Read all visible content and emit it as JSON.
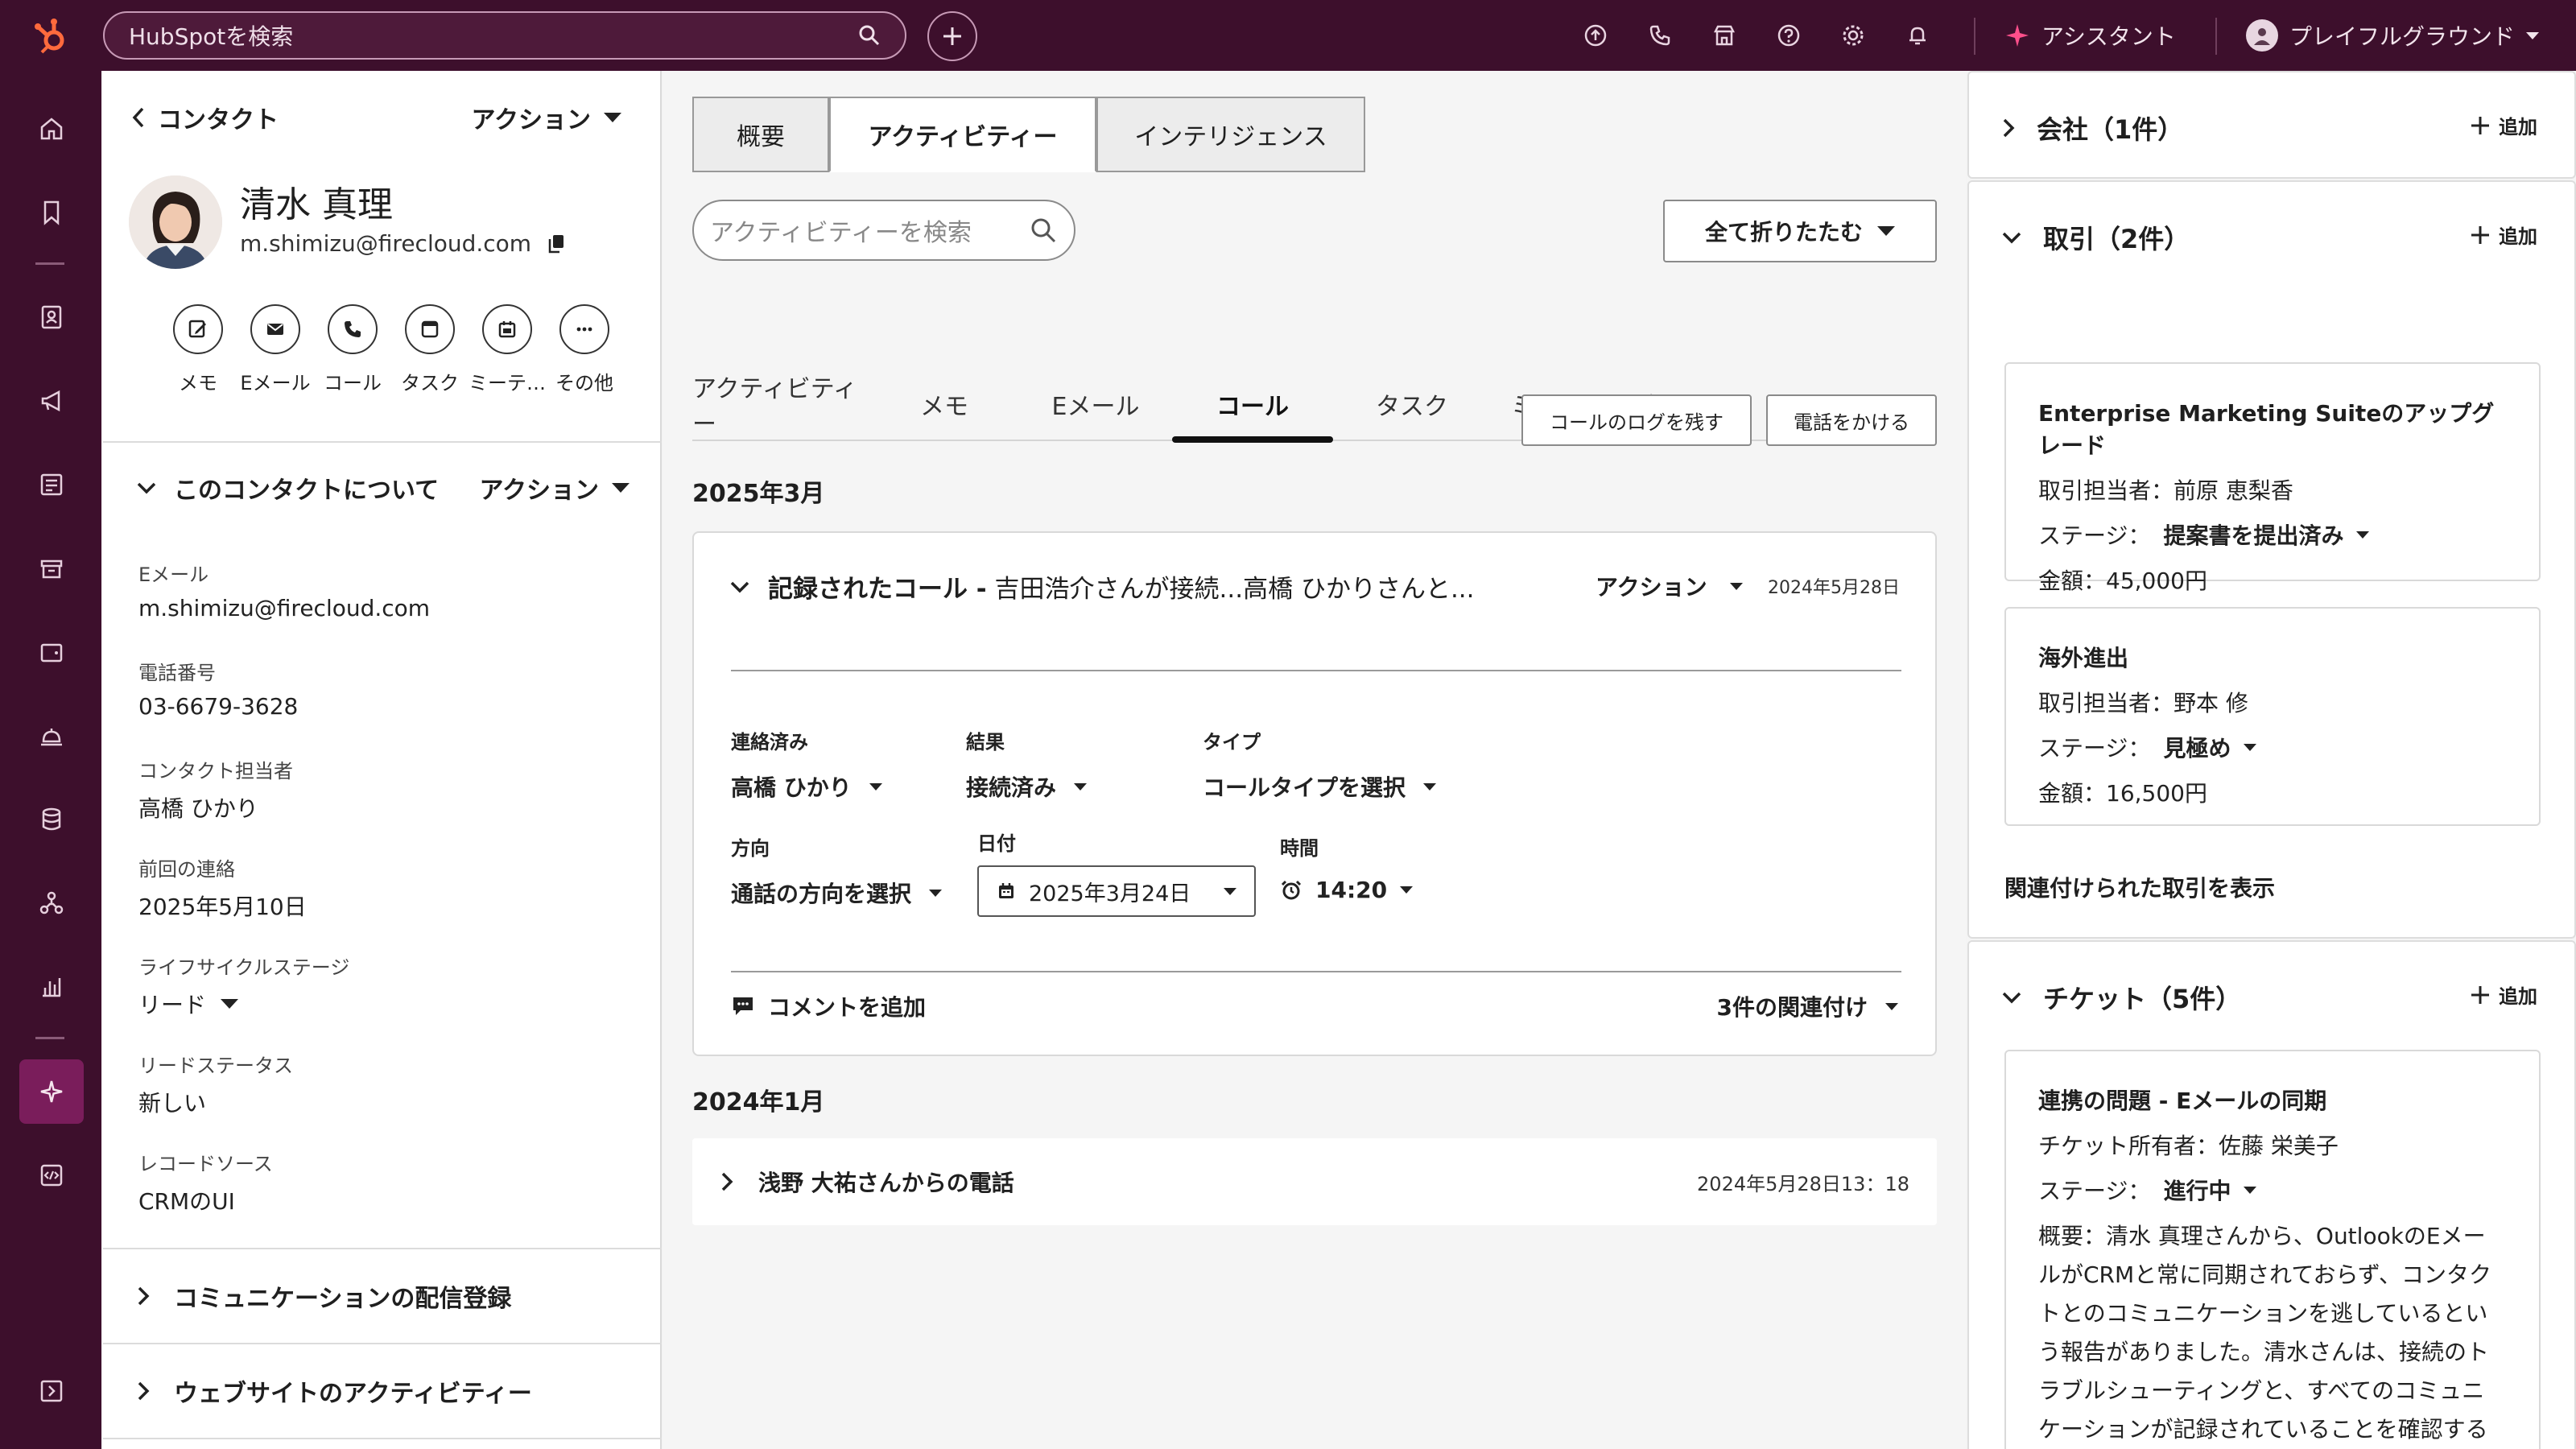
{
  "topbar": {
    "search_placeholder": "HubSpotを検索",
    "assistant_label": "アシスタント",
    "account_label": "プレイフルグラウンド",
    "accent_color": "#3d0f2c"
  },
  "leftpanel": {
    "back_label": "コンタクト",
    "action_label": "アクション",
    "contact_name": "清水 真理",
    "contact_email": "m.shimizu@firecloud.com",
    "quick_actions": [
      "メモ",
      "Eメール",
      "コール",
      "タスク",
      "ミーテ…",
      "その他"
    ],
    "about_title": "このコンタクトについて",
    "about_action": "アクション",
    "properties": [
      {
        "label": "Eメール",
        "value": "m.shimizu@firecloud.com"
      },
      {
        "label": "電話番号",
        "value": "03-6679-3628"
      },
      {
        "label": "コンタクト担当者",
        "value": "高橋 ひかり"
      },
      {
        "label": "前回の連絡",
        "value": "2025年5月10日"
      },
      {
        "label": "ライフサイクルステージ",
        "value": "リード"
      },
      {
        "label": "リードステータス",
        "value": "新しい"
      },
      {
        "label": "レコードソース",
        "value": "CRMのUI"
      }
    ],
    "sections": [
      "コミュニケーションの配信登録",
      "ウェブサイトのアクティビティー"
    ]
  },
  "middle": {
    "top_tabs": [
      "概要",
      "アクティビティー",
      "インテリジェンス"
    ],
    "activity_search_placeholder": "アクティビティーを検索",
    "collapse_all_label": "全て折りたたむ",
    "sub_tabs": [
      "アクティビティー",
      "メモ",
      "Eメール",
      "コール",
      "タスク",
      "ミーティング"
    ],
    "log_call_label": "コールのログを残す",
    "make_call_label": "電話をかける",
    "month_1": "2025年3月",
    "call": {
      "title_bold": "記録されたコール -",
      "title_rest": "吉田浩介さんが接続...高橋 ひかりさんと...",
      "action_label": "アクション",
      "date": "2024年5月28日",
      "contacted_label": "連絡済み",
      "contacted_value": "高橋 ひかり",
      "outcome_label": "結果",
      "outcome_value": "接続済み",
      "type_label": "タイプ",
      "type_value": "コールタイプを選択",
      "direction_label": "方向",
      "direction_value": "通話の方向を選択",
      "date_label": "日付",
      "date_value": "2025年3月24日",
      "time_label": "時間",
      "time_value": "14:20",
      "comment_label": "コメントを追加",
      "associations_label": "3件の関連付け"
    },
    "month_2": "2024年1月",
    "row_call": {
      "title": "浅野 大祐さんからの電話",
      "date": "2024年5月28日13：18"
    }
  },
  "right": {
    "add_label": "追加",
    "company_title": "会社（1件）",
    "deals_title": "取引（2件）",
    "deals": [
      {
        "title": "Enterprise Marketing Suiteのアップグレード",
        "owner": "取引担当者：前原 恵梨香",
        "stage_label": "ステージ：",
        "stage_value": "提案書を提出済み",
        "amount": "金額：45,000円"
      },
      {
        "title": "海外進出",
        "owner": "取引担当者：野本 修",
        "stage_label": "ステージ：",
        "stage_value": "見極め",
        "amount": "金額：16,500円"
      }
    ],
    "deals_link": "関連付けられた取引を表示",
    "tickets_title": "チケット（5件）",
    "ticket": {
      "title": "連携の問題 - Eメールの同期",
      "owner": "チケット所有者：佐藤 栄美子",
      "stage_label": "ステージ：",
      "stage_value": "進行中",
      "summary": "概要：清水 真理さんから、OutlookのEメールがCRMと常に同期されておらず、コンタクトとのコミュニケーションを逃しているという報告がありました。清水さんは、接続のトラブルシューティングと、すべてのコミュニケーションが記録されていることを確認するためのサポートを必要としています。"
    }
  }
}
